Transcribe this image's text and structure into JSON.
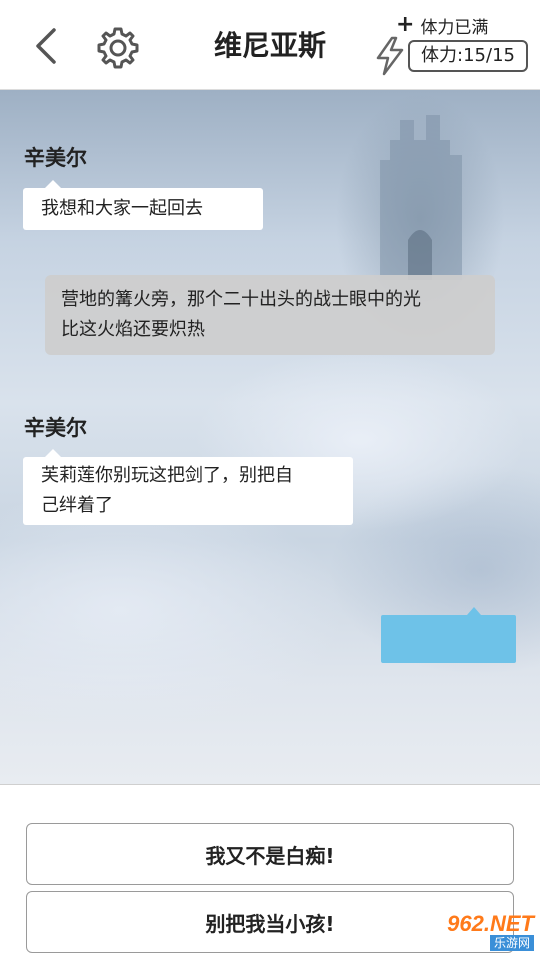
{
  "header": {
    "title": "维尼亚斯",
    "stamina_full_label": "体力已满",
    "stamina_value": "体力:15/15",
    "icons": [
      "back-icon",
      "gear-icon",
      "plus-icon",
      "lightning-icon"
    ]
  },
  "chat": {
    "messages": [
      {
        "speaker": "辛美尔",
        "text": "我想和大家一起回去"
      },
      {
        "narration_lines": [
          "营地的篝火旁，那个二十出头的战士眼中的光",
          "比这火焰还要炽热"
        ]
      },
      {
        "speaker": "辛美尔",
        "text_lines": [
          "芙莉莲你别玩这把剑了，别把自",
          "己绊着了"
        ]
      }
    ],
    "reply_bubble_color": "#6ec2e8"
  },
  "options": {
    "choice_1": "我又不是白痴!",
    "choice_2": "别把我当小孩!"
  },
  "watermark": {
    "top": "962.NET",
    "bottom": "乐游网"
  }
}
